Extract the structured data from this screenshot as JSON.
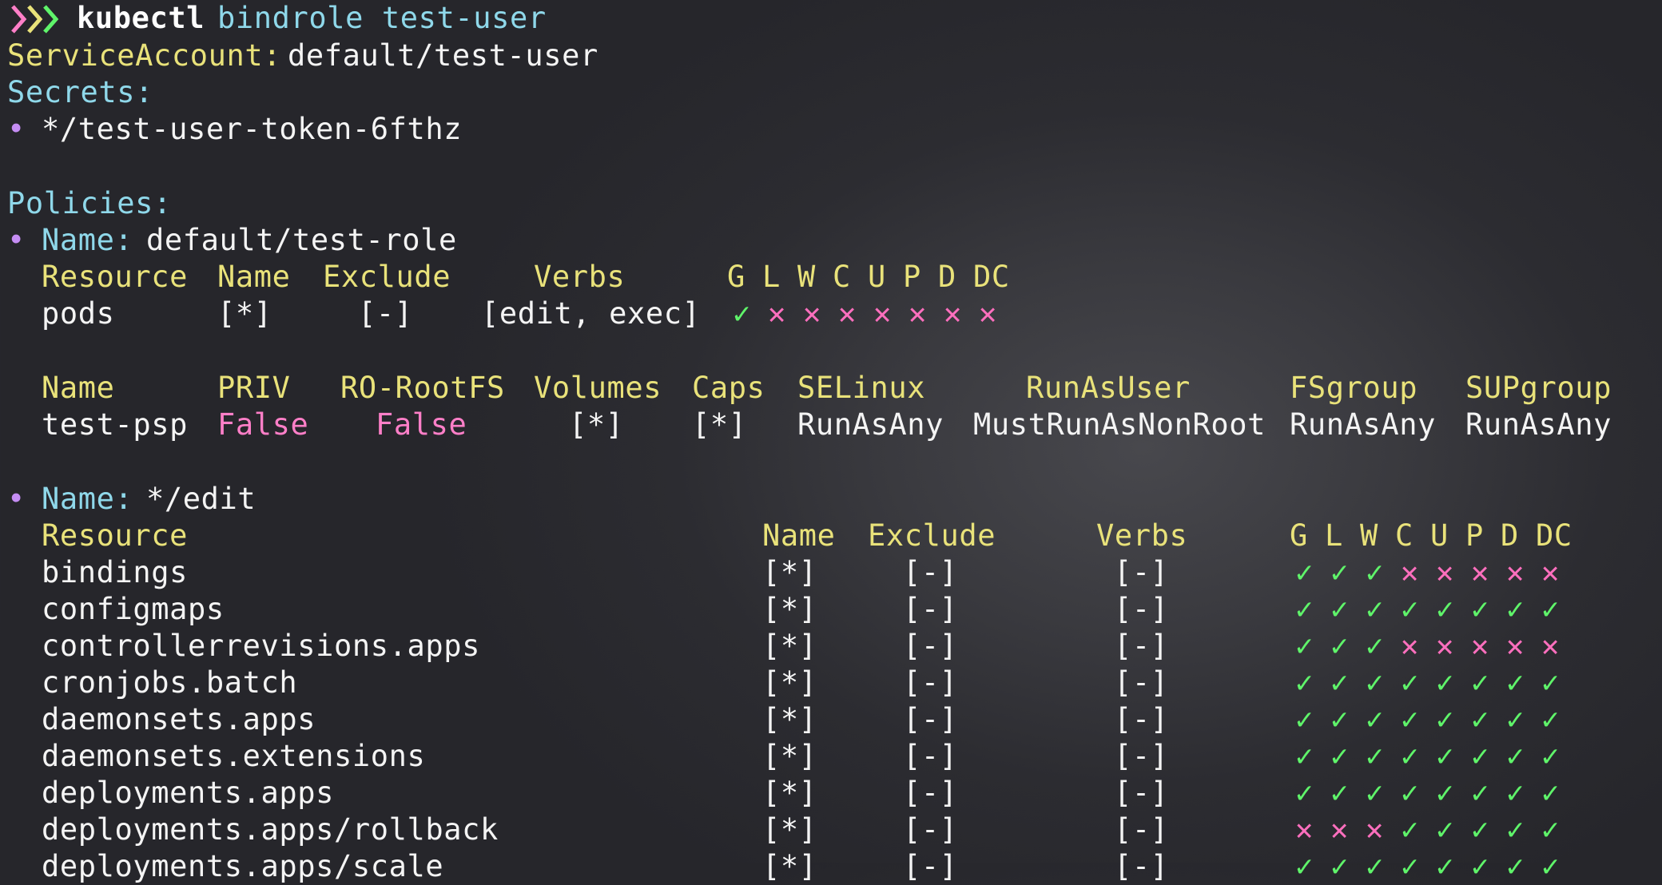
{
  "prompt": {
    "command": "kubectl",
    "args": "bindrole test-user",
    "icon": "chevron-prompt-icon"
  },
  "service_account": {
    "label": "ServiceAccount:",
    "value": "default/test-user"
  },
  "secrets": {
    "label": "Secrets:",
    "bullet": "•",
    "items": [
      "*/test-user-token-6fthz"
    ]
  },
  "policies_label": "Policies:",
  "policy1": {
    "bullet": "•",
    "name_label": "Name:",
    "name_value": "default/test-role",
    "headers": {
      "resource": "Resource",
      "name": "Name",
      "exclude": "Exclude",
      "verbs": "Verbs",
      "flags": [
        "G",
        "L",
        "W",
        "C",
        "U",
        "P",
        "D",
        "DC"
      ]
    },
    "rows": [
      {
        "resource": "pods",
        "name": "[*]",
        "exclude": "[-]",
        "verbs": "[edit, exec]",
        "flags": [
          true,
          false,
          false,
          false,
          false,
          false,
          false,
          false
        ]
      }
    ]
  },
  "psp": {
    "headers": {
      "name": "Name",
      "priv": "PRIV",
      "rofs": "RO-RootFS",
      "volumes": "Volumes",
      "caps": "Caps",
      "selinux": "SELinux",
      "runasuser": "RunAsUser",
      "fsgroup": "FSgroup",
      "supgroup": "SUPgroup"
    },
    "row": {
      "name": "test-psp",
      "priv": "False",
      "rofs": "False",
      "volumes": "[*]",
      "caps": "[*]",
      "selinux": "RunAsAny",
      "runasuser": "MustRunAsNonRoot",
      "fsgroup": "RunAsAny",
      "supgroup": "RunAsAny"
    }
  },
  "policy2": {
    "bullet": "•",
    "name_label": "Name:",
    "name_value": "*/edit",
    "headers": {
      "resource": "Resource",
      "name": "Name",
      "exclude": "Exclude",
      "verbs": "Verbs",
      "flags": [
        "G",
        "L",
        "W",
        "C",
        "U",
        "P",
        "D",
        "DC"
      ]
    },
    "rows": [
      {
        "resource": "bindings",
        "name": "[*]",
        "exclude": "[-]",
        "verbs": "[-]",
        "flags": [
          true,
          true,
          true,
          false,
          false,
          false,
          false,
          false
        ]
      },
      {
        "resource": "configmaps",
        "name": "[*]",
        "exclude": "[-]",
        "verbs": "[-]",
        "flags": [
          true,
          true,
          true,
          true,
          true,
          true,
          true,
          true
        ]
      },
      {
        "resource": "controllerrevisions.apps",
        "name": "[*]",
        "exclude": "[-]",
        "verbs": "[-]",
        "flags": [
          true,
          true,
          true,
          false,
          false,
          false,
          false,
          false
        ]
      },
      {
        "resource": "cronjobs.batch",
        "name": "[*]",
        "exclude": "[-]",
        "verbs": "[-]",
        "flags": [
          true,
          true,
          true,
          true,
          true,
          true,
          true,
          true
        ]
      },
      {
        "resource": "daemonsets.apps",
        "name": "[*]",
        "exclude": "[-]",
        "verbs": "[-]",
        "flags": [
          true,
          true,
          true,
          true,
          true,
          true,
          true,
          true
        ]
      },
      {
        "resource": "daemonsets.extensions",
        "name": "[*]",
        "exclude": "[-]",
        "verbs": "[-]",
        "flags": [
          true,
          true,
          true,
          true,
          true,
          true,
          true,
          true
        ]
      },
      {
        "resource": "deployments.apps",
        "name": "[*]",
        "exclude": "[-]",
        "verbs": "[-]",
        "flags": [
          true,
          true,
          true,
          true,
          true,
          true,
          true,
          true
        ]
      },
      {
        "resource": "deployments.apps/rollback",
        "name": "[*]",
        "exclude": "[-]",
        "verbs": "[-]",
        "flags": [
          false,
          false,
          false,
          true,
          true,
          true,
          true,
          true
        ]
      },
      {
        "resource": "deployments.apps/scale",
        "name": "[*]",
        "exclude": "[-]",
        "verbs": "[-]",
        "flags": [
          true,
          true,
          true,
          true,
          true,
          true,
          true,
          true
        ]
      }
    ]
  },
  "glyphs": {
    "allowed": "✓",
    "denied": "✕"
  },
  "colors": {
    "label": "#e9e27a",
    "cyan": "#8fd8ea",
    "pink": "#ff7fc8",
    "allowed": "#5ff46a",
    "denied": "#ff6fbe",
    "bullet": "#c58df4"
  }
}
